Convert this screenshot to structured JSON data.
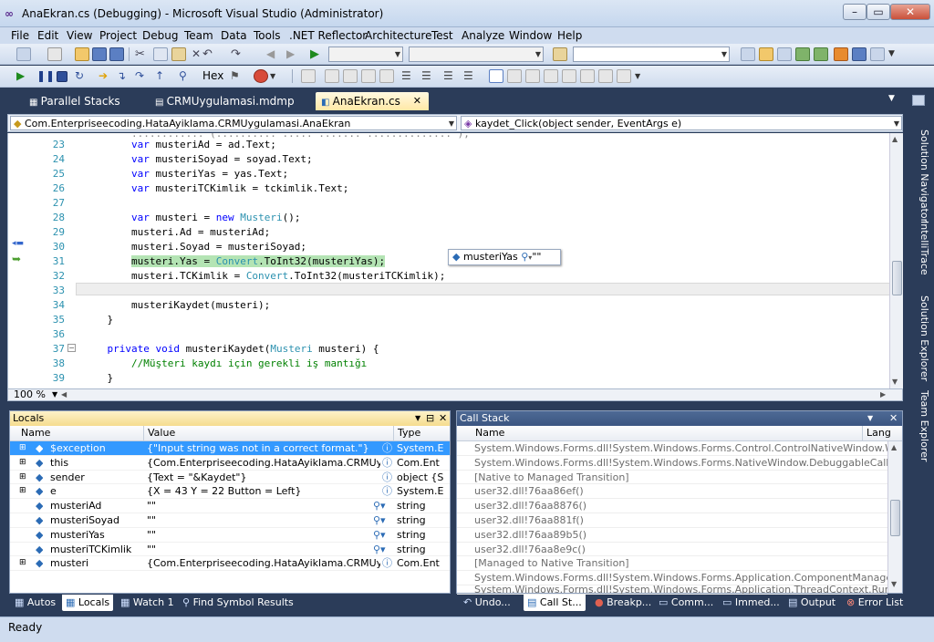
{
  "window": {
    "title": "AnaEkran.cs (Debugging) - Microsoft Visual Studio (Administrator)"
  },
  "menu": [
    "File",
    "Edit",
    "View",
    "Project",
    "Debug",
    "Team",
    "Data",
    "Tools",
    ".NET Reflector",
    "Architecture",
    "Test",
    "Analyze",
    "Window",
    "Help"
  ],
  "toolbar": {
    "hex_label": "Hex"
  },
  "doc_tabs": [
    "Parallel Stacks",
    "CRMUygulamasi.mdmp",
    "AnaEkran.cs"
  ],
  "nav": {
    "class_combo": "Com.Enterpriseecoding.HataAyiklama.CRMUygulamasi.AnaEkran",
    "member_combo": "kaydet_Click(object sender, EventArgs e)"
  },
  "code_lines": [
    {
      "num": "23",
      "text": "        var musteriAd = ad.Text;"
    },
    {
      "num": "24",
      "text": "        var musteriSoyad = soyad.Text;"
    },
    {
      "num": "25",
      "text": "        var musteriYas = yas.Text;"
    },
    {
      "num": "26",
      "text": "        var musteriTCKimlik = tckimlik.Text;"
    },
    {
      "num": "27",
      "text": ""
    },
    {
      "num": "28",
      "text": "        var musteri = new Musteri();"
    },
    {
      "num": "29",
      "text": "        musteri.Ad = musteriAd;"
    },
    {
      "num": "30",
      "text": "        musteri.Soyad = musteriSoyad;"
    },
    {
      "num": "31",
      "text": "        musteri.Yas = Convert.ToInt32(musteriYas);"
    },
    {
      "num": "32",
      "text": "        musteri.TCKimlik = Convert.ToInt32(musteriTCKimlik);"
    },
    {
      "num": "33",
      "text": ""
    },
    {
      "num": "34",
      "text": "        musteriKaydet(musteri);"
    },
    {
      "num": "35",
      "text": "    }"
    },
    {
      "num": "36",
      "text": ""
    },
    {
      "num": "37",
      "text": "    private void musteriKaydet(Musteri musteri) {"
    },
    {
      "num": "38",
      "text": "        //Müşteri kaydı için gerekli iş mantığı"
    },
    {
      "num": "39",
      "text": "    }"
    }
  ],
  "datatip": {
    "name": "musteriYas",
    "value": "\"\""
  },
  "zoom": "100 %",
  "locals": {
    "title": "Locals",
    "columns": [
      "Name",
      "Value",
      "Type"
    ],
    "rows": [
      {
        "name": "$exception",
        "value": "{\"Input string was not in a correct format.\"}",
        "type": "System.E"
      },
      {
        "name": "this",
        "value": "{Com.Enterpriseecoding.HataAyiklama.CRMUygulam",
        "type": "Com.Ent"
      },
      {
        "name": "sender",
        "value": "{Text = \"&Kaydet\"}",
        "type": "object {S"
      },
      {
        "name": "e",
        "value": "{X = 43 Y = 22 Button = Left}",
        "type": "System.E"
      },
      {
        "name": "musteriAd",
        "value": "\"\"",
        "type": "string"
      },
      {
        "name": "musteriSoyad",
        "value": "\"\"",
        "type": "string"
      },
      {
        "name": "musteriYas",
        "value": "\"\"",
        "type": "string"
      },
      {
        "name": "musteriTCKimlik",
        "value": "\"\"",
        "type": "string"
      },
      {
        "name": "musteri",
        "value": "{Com.Enterpriseecoding.HataAyiklama.CRMUygulam",
        "type": "Com.Ent"
      }
    ]
  },
  "callstack": {
    "title": "Call Stack",
    "columns": [
      "Name",
      "Lang"
    ],
    "rows": [
      "System.Windows.Forms.dll!System.Windows.Forms.Control.ControlNativeWindow.Wnd",
      "System.Windows.Forms.dll!System.Windows.Forms.NativeWindow.DebuggableCallbac",
      "[Native to Managed Transition]",
      "user32.dll!76aa86ef()",
      "user32.dll!76aa8876()",
      "user32.dll!76aa881f()",
      "user32.dll!76aa89b5()",
      "user32.dll!76aa8e9c()",
      "[Managed to Native Transition]",
      "System.Windows.Forms.dll!System.Windows.Forms.Application.ComponentManager.S",
      "System.Windows.Forms.dll!System.Windows.Forms.Application.ThreadContext.RunM"
    ]
  },
  "bottom_tabs_left": [
    "Autos",
    "Locals",
    "Watch 1",
    "Find Symbol Results"
  ],
  "bottom_tabs_right": [
    "Undo...",
    "Call St...",
    "Breakp...",
    "Comm...",
    "Immed...",
    "Output",
    "Error List"
  ],
  "right_rail": [
    "Solution Navigator",
    "IntelliTrace",
    "Solution Explorer",
    "Team Explorer"
  ],
  "status": "Ready"
}
